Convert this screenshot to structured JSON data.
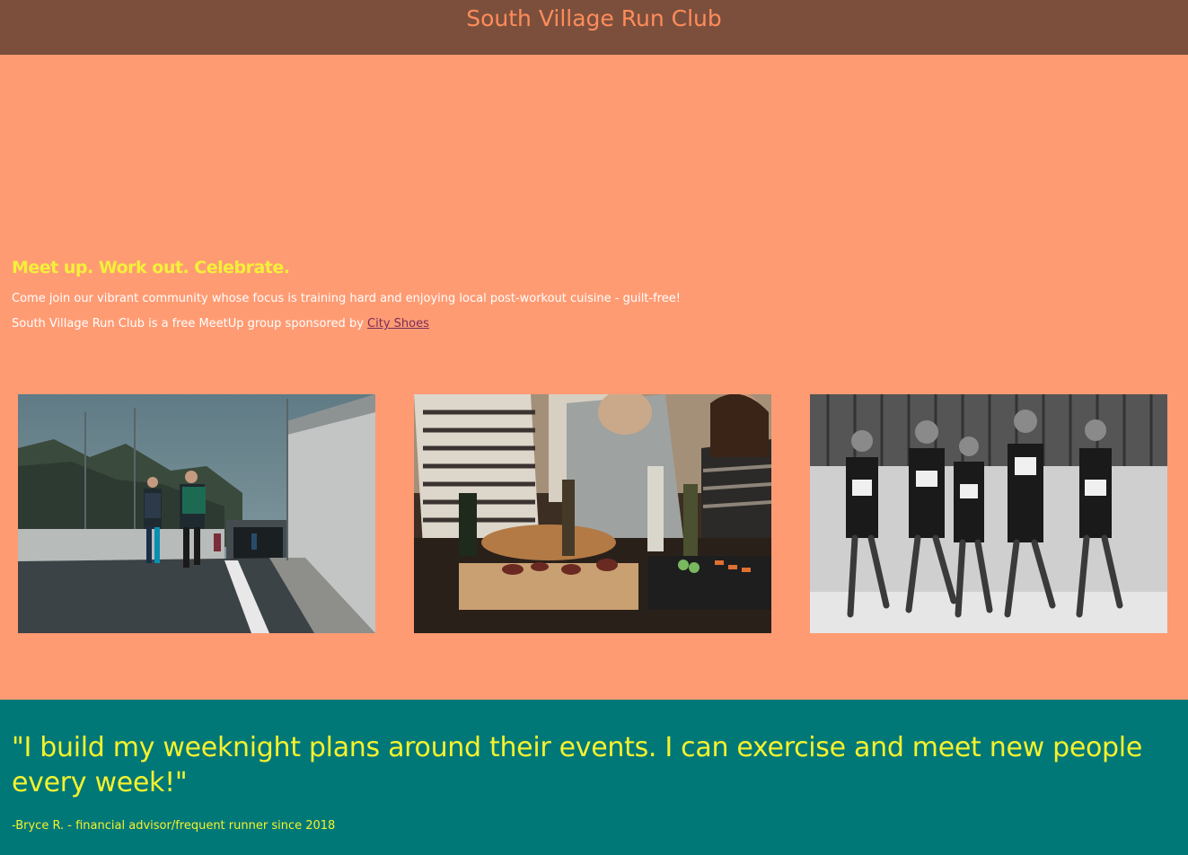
{
  "header": {
    "title": "South Village Run Club"
  },
  "hero": {
    "tagline": "Meet up. Work out. Celebrate.",
    "intro": "Come join our vibrant community whose focus is training hard and enjoying local post-workout cuisine - guilt-free!",
    "sponsor_prefix": "South Village Run Club is a free MeetUp group sponsored by ",
    "sponsor_link": "City Shoes"
  },
  "testimonial": {
    "quote": "\"I build my weeknight plans around their events. I can exercise and meet new people every week!\"",
    "attribution": "-Bryce R. - financial advisor/frequent runner since 2018"
  },
  "colors": {
    "header_bg": "#7c4f3d",
    "title": "#ff8c5a",
    "hero_bg": "#ff9b73",
    "accent_yellow": "#f3f03a",
    "link": "#7a2c5a",
    "testimonial_bg": "#017878"
  }
}
